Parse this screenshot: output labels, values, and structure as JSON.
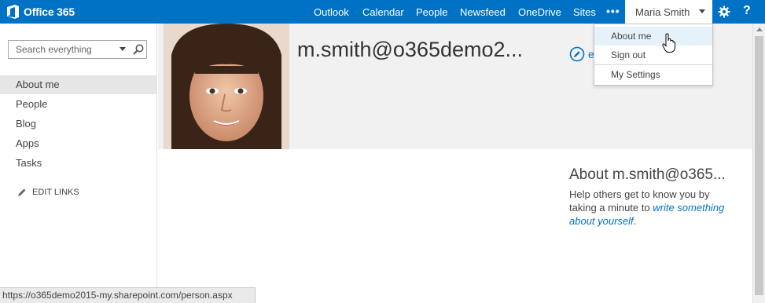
{
  "app": {
    "brand": "Office 365"
  },
  "nav": {
    "links": [
      "Outlook",
      "Calendar",
      "People",
      "Newsfeed",
      "OneDrive",
      "Sites"
    ],
    "more": "•••",
    "user_name": "Maria Smith",
    "help": "?"
  },
  "search": {
    "placeholder": "Search everything"
  },
  "sidebar": {
    "items": [
      {
        "label": "About me",
        "selected": true
      },
      {
        "label": "People",
        "selected": false
      },
      {
        "label": "Blog",
        "selected": false
      },
      {
        "label": "Apps",
        "selected": false
      },
      {
        "label": "Tasks",
        "selected": false
      }
    ],
    "edit_links": "EDIT LINKS"
  },
  "profile": {
    "title": "m.smith@o365demo2...",
    "edit_partial": "e"
  },
  "about": {
    "title": "About m.smith@o365...",
    "text_before": "Help others get to know you by taking a minute to ",
    "link": "write something about yourself",
    "text_after": "."
  },
  "user_menu": {
    "items": [
      "About me",
      "Sign out",
      "My Settings"
    ]
  },
  "status_bar": {
    "url": "https://o365demo2015-my.sharepoint.com/person.aspx"
  },
  "colors": {
    "accent": "#0072c6",
    "band": "#f1f1f1",
    "selected": "#e6e6e6"
  }
}
